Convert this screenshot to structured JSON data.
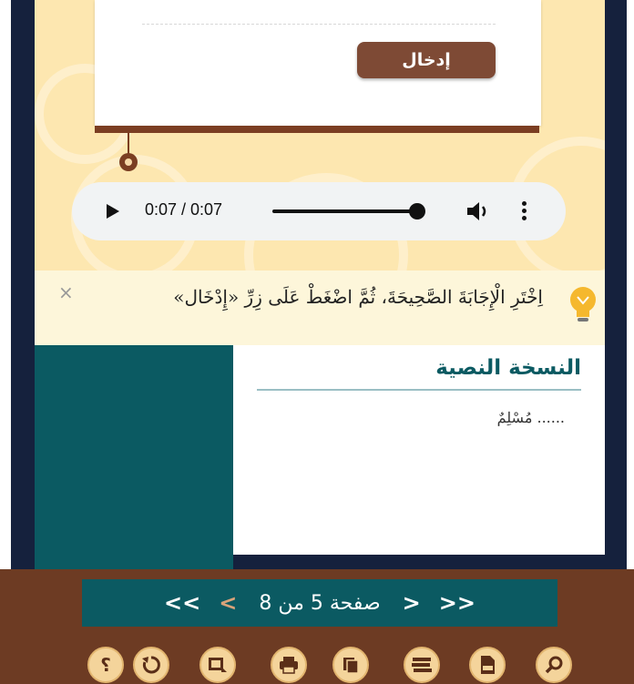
{
  "activity": {
    "enter_button": "إدخال"
  },
  "audio": {
    "time": "0:07 / 0:07",
    "progress": 1.0
  },
  "hint": {
    "text": "اِخْتَرِ الْإِجَابَةَ الصَّحِيحَةَ، ثُمَّ اضْغَطْ عَلَى زِرِّ «إِدْخَال»",
    "close": "×"
  },
  "text_version": {
    "title": "النسخة النصية",
    "body": "...... مُسْلِمٌ"
  },
  "pagination": {
    "label": "صفحة 5 من 8",
    "first": "<<",
    "prev": "<",
    "next": ">",
    "last": ">>"
  },
  "toolbar": {
    "help_icon": "؟"
  },
  "colors": {
    "frame": "#15213d",
    "teal": "#0b5a62",
    "brown": "#6d3b23",
    "button": "#7e4a35",
    "stage": "#fde7b0"
  }
}
